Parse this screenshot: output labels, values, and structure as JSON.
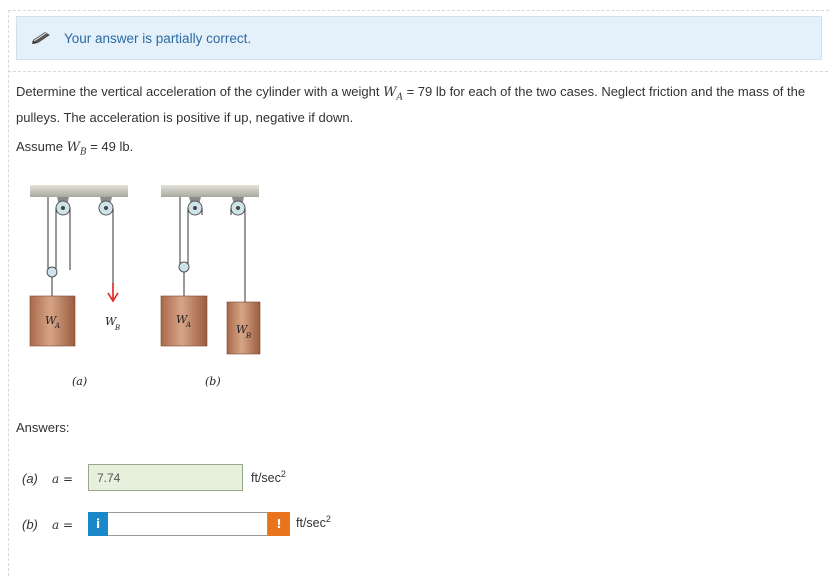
{
  "banner": {
    "message": "Your answer is partially correct.",
    "icon": "pencil-icon"
  },
  "problem": {
    "text_before": "Determine the vertical acceleration of the cylinder with a weight ",
    "wa_symbol": "W",
    "wa_sub": "A",
    "wa_value": " = 79 lb for each of the two cases. Neglect friction and the mass of the pulleys. The acceleration is positive if up, negative if down."
  },
  "assume": {
    "prefix": "Assume ",
    "wb_symbol": "W",
    "wb_sub": "B",
    "wb_value": " = 49 lb."
  },
  "figure": {
    "case_a_label": "(a)",
    "case_b_label": "(b)",
    "weight_a_label": "W",
    "weight_a_sub": "A",
    "weight_b_label": "W",
    "weight_b_sub": "B"
  },
  "answers": {
    "label": "Answers:",
    "row_a": {
      "part": "(a)",
      "var": "a =",
      "value": "7.74",
      "unit": "ft/sec",
      "unit_exp": "2",
      "status": "correct"
    },
    "row_b": {
      "part": "(b)",
      "var": "a =",
      "value": "",
      "unit": "ft/sec",
      "unit_exp": "2",
      "status": "incorrect",
      "info_icon": "i",
      "warn_icon": "!"
    }
  },
  "colors": {
    "banner_bg": "#e5f1fa",
    "banner_text": "#2a6aa3",
    "correct_bg": "#e6f0dc",
    "info": "#1a88c8",
    "warning": "#e8741e",
    "arrow": "#e02020",
    "block": "#c98866"
  }
}
